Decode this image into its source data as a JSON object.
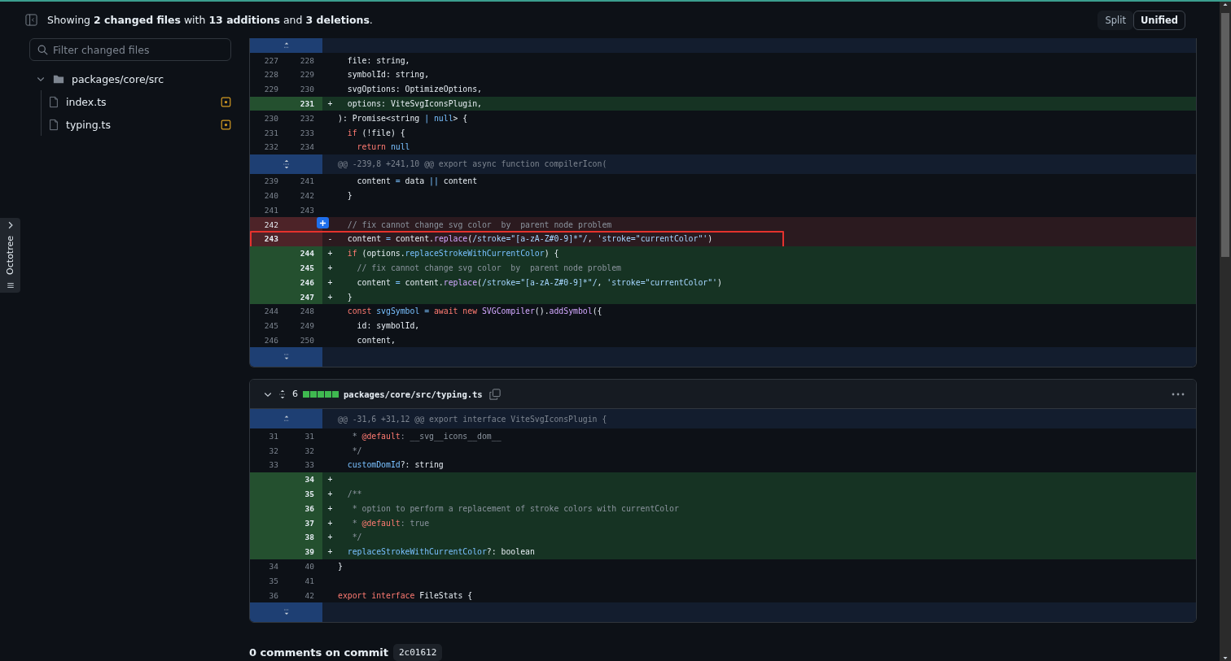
{
  "octotree": {
    "label": "Octotree"
  },
  "header": {
    "summary": "Showing **2 changed files** with **13 additions** and **3 deletions**.",
    "view_modes": [
      {
        "label": "Split",
        "selected": false
      },
      {
        "label": "Unified",
        "selected": true
      }
    ]
  },
  "sidebar": {
    "filter": {
      "placeholder": "Filter changed files"
    },
    "tree": [
      {
        "name": "packages/core/src",
        "kind": "folder",
        "expanded": true,
        "children": [
          {
            "name": "index.ts",
            "kind": "file",
            "modified": true
          },
          {
            "name": "typing.ts",
            "kind": "file",
            "modified": true
          }
        ]
      }
    ]
  },
  "files": [
    {
      "lines": [
        {
          "kind": "hunk",
          "expand_up": true,
          "expand_down": false
        },
        {
          "kind": "context",
          "old": "227",
          "new": "228",
          "boxed": false,
          "comment_button": false,
          "code": [
            {
              "kind": "plain",
              "text": "  file: string,"
            }
          ]
        },
        {
          "kind": "context",
          "old": "228",
          "new": "229",
          "boxed": false,
          "comment_button": false,
          "code": [
            {
              "kind": "plain",
              "text": "  symbolId: string,"
            }
          ]
        },
        {
          "kind": "context",
          "old": "229",
          "new": "230",
          "boxed": false,
          "comment_button": false,
          "code": [
            {
              "kind": "plain",
              "text": "  svgOptions: OptimizeOptions,"
            }
          ]
        },
        {
          "kind": "add",
          "new": "231",
          "marker": "+",
          "boxed": false,
          "comment_button": false,
          "code": [
            {
              "kind": "plain",
              "text": "  options: ViteSvgIconsPlugin,"
            }
          ]
        },
        {
          "kind": "context",
          "old": "230",
          "new": "232",
          "boxed": false,
          "comment_button": false,
          "code": [
            {
              "kind": "plain",
              "text": "): Promise<string "
            },
            {
              "kind": "constant",
              "text": "|"
            },
            {
              "kind": "constant",
              "text": " null"
            },
            {
              "kind": "plain",
              "text": "> {"
            }
          ]
        },
        {
          "kind": "context",
          "old": "231",
          "new": "233",
          "boxed": false,
          "comment_button": false,
          "code": [
            {
              "kind": "keyword",
              "text": "  if"
            },
            {
              "kind": "plain",
              "text": " (!file) {"
            }
          ]
        },
        {
          "kind": "context",
          "old": "232",
          "new": "234",
          "boxed": false,
          "comment_button": false,
          "code": [
            {
              "kind": "keyword",
              "text": "    return"
            },
            {
              "kind": "constant",
              "text": " null"
            }
          ]
        },
        {
          "kind": "hunk",
          "expand_up": true,
          "expand_down": true,
          "text": "@@ -239,8 +241,10 @@ export async function compilerIcon("
        },
        {
          "kind": "context",
          "old": "239",
          "new": "241",
          "boxed": false,
          "comment_button": false,
          "code": [
            {
              "kind": "plain",
              "text": "    content "
            },
            {
              "kind": "constant",
              "text": "="
            },
            {
              "kind": "plain",
              "text": " data "
            },
            {
              "kind": "constant",
              "text": "||"
            },
            {
              "kind": "plain",
              "text": " content"
            }
          ]
        },
        {
          "kind": "context",
          "old": "240",
          "new": "242",
          "boxed": false,
          "comment_button": false,
          "code": [
            {
              "kind": "plain",
              "text": "  }"
            }
          ]
        },
        {
          "kind": "context",
          "old": "241",
          "new": "243",
          "boxed": false,
          "comment_button": false
        },
        {
          "kind": "del",
          "old": "242",
          "boxed": false,
          "comment_button": true,
          "code": [
            {
              "kind": "comment",
              "text": "  // fix cannot change svg color  by  parent node problem"
            }
          ]
        },
        {
          "kind": "del",
          "old": "243",
          "marker": "-",
          "boxed": true,
          "comment_button": false,
          "code": [
            {
              "kind": "plain",
              "text": "  content "
            },
            {
              "kind": "constant",
              "text": "="
            },
            {
              "kind": "plain",
              "text": " content."
            },
            {
              "kind": "function",
              "text": "replace"
            },
            {
              "kind": "plain",
              "text": "("
            },
            {
              "kind": "string",
              "text": "/stroke=\"[a-zA-Z#0-9]*\"/"
            },
            {
              "kind": "plain",
              "text": ", "
            },
            {
              "kind": "string",
              "text": "'stroke=\"currentColor\"'"
            },
            {
              "kind": "plain",
              "text": ")"
            }
          ]
        },
        {
          "kind": "add",
          "new": "244",
          "marker": "+",
          "boxed": false,
          "comment_button": false,
          "code": [
            {
              "kind": "keyword",
              "text": "  if"
            },
            {
              "kind": "plain",
              "text": " (options."
            },
            {
              "kind": "constant",
              "text": "replaceStrokeWithCurrentColor"
            },
            {
              "kind": "plain",
              "text": ") {"
            }
          ]
        },
        {
          "kind": "add",
          "new": "245",
          "marker": "+",
          "boxed": false,
          "comment_button": false,
          "code": [
            {
              "kind": "comment",
              "text": "    // fix cannot change svg color  by  parent node problem"
            }
          ]
        },
        {
          "kind": "add",
          "new": "246",
          "marker": "+",
          "boxed": false,
          "comment_button": false,
          "code": [
            {
              "kind": "plain",
              "text": "    content "
            },
            {
              "kind": "constant",
              "text": "="
            },
            {
              "kind": "plain",
              "text": " content."
            },
            {
              "kind": "function",
              "text": "replace"
            },
            {
              "kind": "plain",
              "text": "("
            },
            {
              "kind": "string",
              "text": "/stroke=\"[a-zA-Z#0-9]*\"/"
            },
            {
              "kind": "plain",
              "text": ", "
            },
            {
              "kind": "string",
              "text": "'stroke=\"currentColor\"'"
            },
            {
              "kind": "plain",
              "text": ")"
            }
          ]
        },
        {
          "kind": "add",
          "new": "247",
          "marker": "+",
          "boxed": false,
          "comment_button": false,
          "code": [
            {
              "kind": "plain",
              "text": "  }"
            }
          ]
        },
        {
          "kind": "context",
          "old": "244",
          "new": "248",
          "boxed": false,
          "comment_button": false,
          "code": [
            {
              "kind": "keyword",
              "text": "  const"
            },
            {
              "kind": "constant",
              "text": " svgSymbol"
            },
            {
              "kind": "constant",
              "text": " ="
            },
            {
              "kind": "keyword",
              "text": " await new"
            },
            {
              "kind": "function",
              "text": " SVGCompiler"
            },
            {
              "kind": "plain",
              "text": "()."
            },
            {
              "kind": "function",
              "text": "addSymbol"
            },
            {
              "kind": "plain",
              "text": "({"
            }
          ]
        },
        {
          "kind": "context",
          "old": "245",
          "new": "249",
          "boxed": false,
          "comment_button": false,
          "code": [
            {
              "kind": "plain",
              "text": "    id: symbolId,"
            }
          ]
        },
        {
          "kind": "context",
          "old": "246",
          "new": "250",
          "boxed": false,
          "comment_button": false,
          "code": [
            {
              "kind": "plain",
              "text": "    content,"
            }
          ]
        },
        {
          "kind": "hunk",
          "expand_up": false,
          "expand_down": true
        }
      ]
    },
    {
      "header": {
        "expanded": true,
        "changes": "6",
        "stat_blocks": [
          {
            "kind": "add"
          },
          {
            "kind": "add"
          },
          {
            "kind": "add"
          },
          {
            "kind": "add"
          },
          {
            "kind": "add"
          }
        ],
        "path": "packages/core/src/typing.ts"
      },
      "lines": [
        {
          "kind": "hunk",
          "expand_up": true,
          "expand_down": false,
          "text": "@@ -31,6 +31,12 @@ export interface ViteSvgIconsPlugin {"
        },
        {
          "kind": "context",
          "old": "31",
          "new": "31",
          "boxed": false,
          "comment_button": false,
          "code": [
            {
              "kind": "comment",
              "text": "   * "
            },
            {
              "kind": "keyword",
              "text": "@default"
            },
            {
              "kind": "comment",
              "text": ": __svg__icons__dom__"
            }
          ]
        },
        {
          "kind": "context",
          "old": "32",
          "new": "32",
          "boxed": false,
          "comment_button": false,
          "code": [
            {
              "kind": "comment",
              "text": "   */"
            }
          ]
        },
        {
          "kind": "context",
          "old": "33",
          "new": "33",
          "boxed": false,
          "comment_button": false,
          "code": [
            {
              "kind": "constant",
              "text": "  customDomId"
            },
            {
              "kind": "plain",
              "text": "?: string"
            }
          ]
        },
        {
          "kind": "add",
          "new": "34",
          "marker": "+",
          "boxed": false,
          "comment_button": false
        },
        {
          "kind": "add",
          "new": "35",
          "marker": "+",
          "boxed": false,
          "comment_button": false,
          "code": [
            {
              "kind": "comment",
              "text": "  /**"
            }
          ]
        },
        {
          "kind": "add",
          "new": "36",
          "marker": "+",
          "boxed": false,
          "comment_button": false,
          "code": [
            {
              "kind": "comment",
              "text": "   * option to perform a replacement of stroke colors with currentColor"
            }
          ]
        },
        {
          "kind": "add",
          "new": "37",
          "marker": "+",
          "boxed": false,
          "comment_button": false,
          "code": [
            {
              "kind": "comment",
              "text": "   * "
            },
            {
              "kind": "keyword",
              "text": "@default"
            },
            {
              "kind": "comment",
              "text": ": true"
            }
          ]
        },
        {
          "kind": "add",
          "new": "38",
          "marker": "+",
          "boxed": false,
          "comment_button": false,
          "code": [
            {
              "kind": "comment",
              "text": "   */"
            }
          ]
        },
        {
          "kind": "add",
          "new": "39",
          "marker": "+",
          "boxed": false,
          "comment_button": false,
          "code": [
            {
              "kind": "constant",
              "text": "  replaceStrokeWithCurrentColor"
            },
            {
              "kind": "plain",
              "text": "?: boolean"
            }
          ]
        },
        {
          "kind": "context",
          "old": "34",
          "new": "40",
          "boxed": false,
          "comment_button": false,
          "code": [
            {
              "kind": "plain",
              "text": "}"
            }
          ]
        },
        {
          "kind": "context",
          "old": "35",
          "new": "41",
          "boxed": false,
          "comment_button": false
        },
        {
          "kind": "context",
          "old": "36",
          "new": "42",
          "boxed": false,
          "comment_button": false,
          "code": [
            {
              "kind": "keyword",
              "text": "export interface"
            },
            {
              "kind": "plain",
              "text": " FileStats {"
            }
          ]
        },
        {
          "kind": "hunk",
          "expand_up": false,
          "expand_down": true
        }
      ]
    }
  ],
  "footer": {
    "label": "0 comments on commit",
    "commit": "2c01612"
  }
}
